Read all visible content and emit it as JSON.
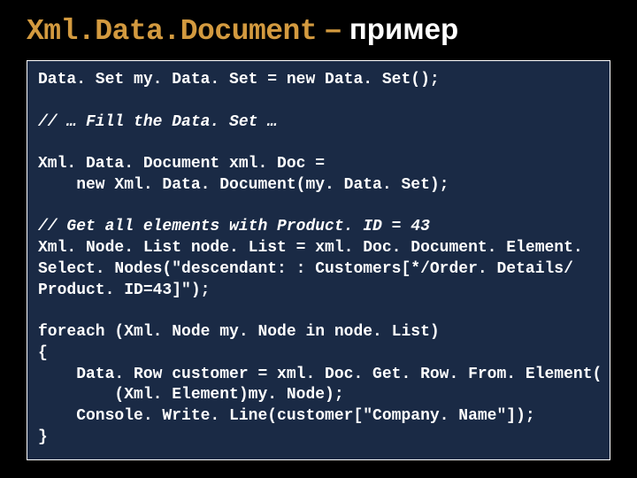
{
  "title": {
    "class": "Xml.Data.Document",
    "dash": " – ",
    "word": "пример"
  },
  "code": {
    "l1": "Data. Set my. Data. Set = new Data. Set();",
    "l2": "// … Fill the Data. Set …",
    "l3": "Xml. Data. Document xml. Doc =",
    "l4": "    new Xml. Data. Document(my. Data. Set);",
    "l5": "// Get all elements with Product. ID = 43",
    "l6": "Xml. Node. List node. List = xml. Doc. Document. Element.",
    "l7": "Select. Nodes(\"descendant: : Customers[*/Order. Details/",
    "l8": "Product. ID=43]\");",
    "l9": "foreach (Xml. Node my. Node in node. List)",
    "l10": "{",
    "l11": "    Data. Row customer = xml. Doc. Get. Row. From. Element(",
    "l12": "        (Xml. Element)my. Node);",
    "l13": "    Console. Write. Line(customer[\"Company. Name\"]);",
    "l14": "}"
  }
}
